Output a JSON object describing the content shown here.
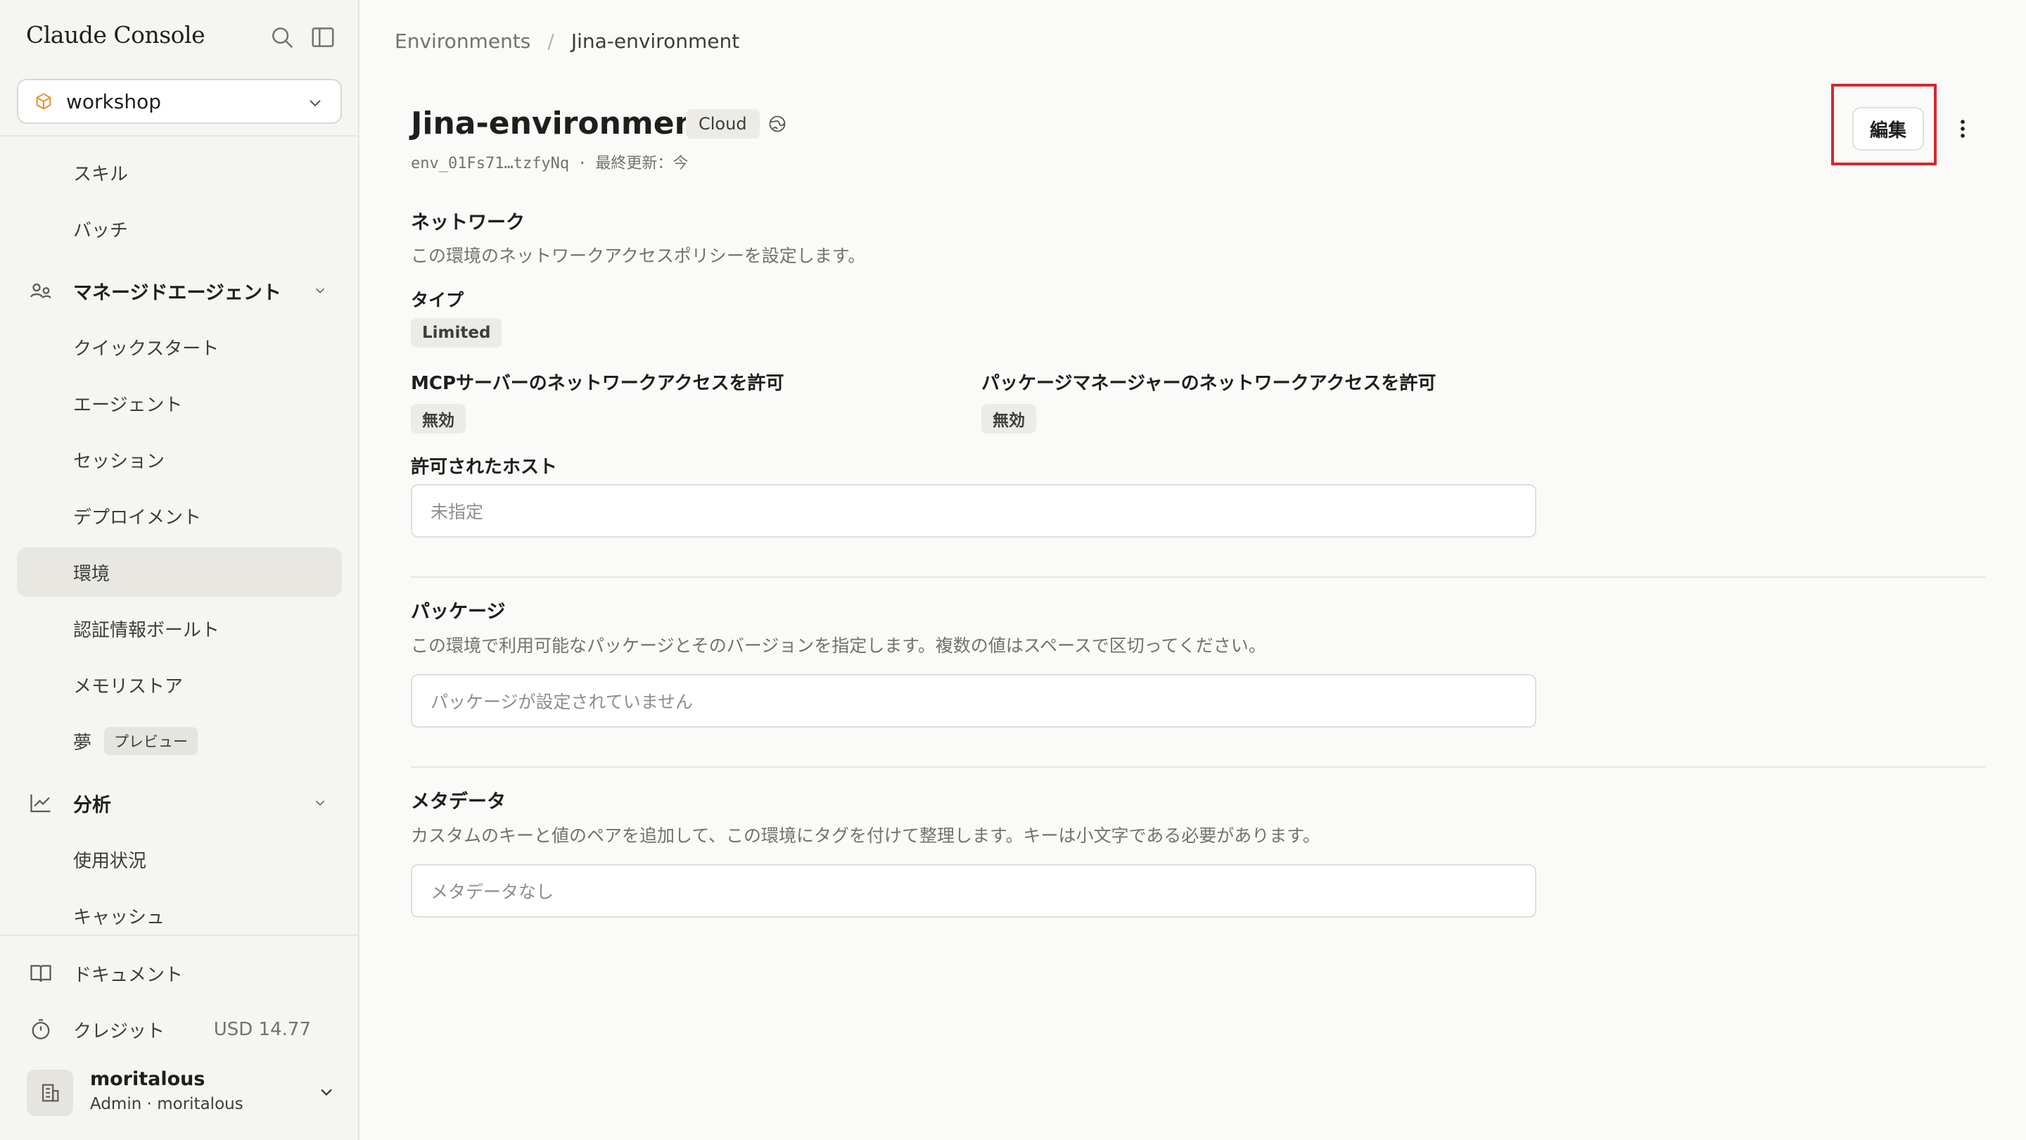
{
  "sidebar": {
    "brand": "Claude Console",
    "workspace": "workshop",
    "items": [
      {
        "label": "スキル"
      },
      {
        "label": "バッチ"
      },
      {
        "label": "マネージドエージェント"
      },
      {
        "label": "クイックスタート"
      },
      {
        "label": "エージェント"
      },
      {
        "label": "セッション"
      },
      {
        "label": "デプロイメント"
      },
      {
        "label": "環境"
      },
      {
        "label": "認証情報ボールト"
      },
      {
        "label": "メモリストア"
      },
      {
        "label": "夢",
        "badge": "プレビュー"
      },
      {
        "label": "分析"
      },
      {
        "label": "使用状況"
      },
      {
        "label": "キャッシュ"
      }
    ],
    "docs_label": "ドキュメント",
    "credit_label": "クレジット",
    "credit_value": "USD 14.77",
    "user": {
      "name": "moritalous",
      "role": "Admin",
      "org": "moritalous"
    }
  },
  "breadcrumb": {
    "parent": "Environments",
    "current": "Jina-environment"
  },
  "env": {
    "name": "Jina-environment",
    "badge": "Cloud",
    "id": "env_01Fs71…tzfyNq",
    "updated": "最終更新：今",
    "edit_label": "編集"
  },
  "network": {
    "title": "ネットワーク",
    "desc": "この環境のネットワークアクセスポリシーを設定します。",
    "type_label": "タイプ",
    "type_value": "Limited",
    "mcp_label": "MCPサーバーのネットワークアクセスを許可",
    "mcp_value": "無効",
    "pkg_label": "パッケージマネージャーのネットワークアクセスを許可",
    "pkg_value": "無効",
    "hosts_label": "許可されたホスト",
    "hosts_placeholder": "未指定"
  },
  "packages": {
    "title": "パッケージ",
    "desc": "この環境で利用可能なパッケージとそのバージョンを指定します。複数の値はスペースで区切ってください。",
    "placeholder": "パッケージが設定されていません"
  },
  "metadata": {
    "title": "メタデータ",
    "desc": "カスタムのキーと値のペアを追加して、この環境にタグを付けて整理します。キーは小文字である必要があります。",
    "placeholder": "メタデータなし"
  },
  "colors": {
    "highlight": "#d9262c",
    "accent_cube": "#e8933a"
  }
}
